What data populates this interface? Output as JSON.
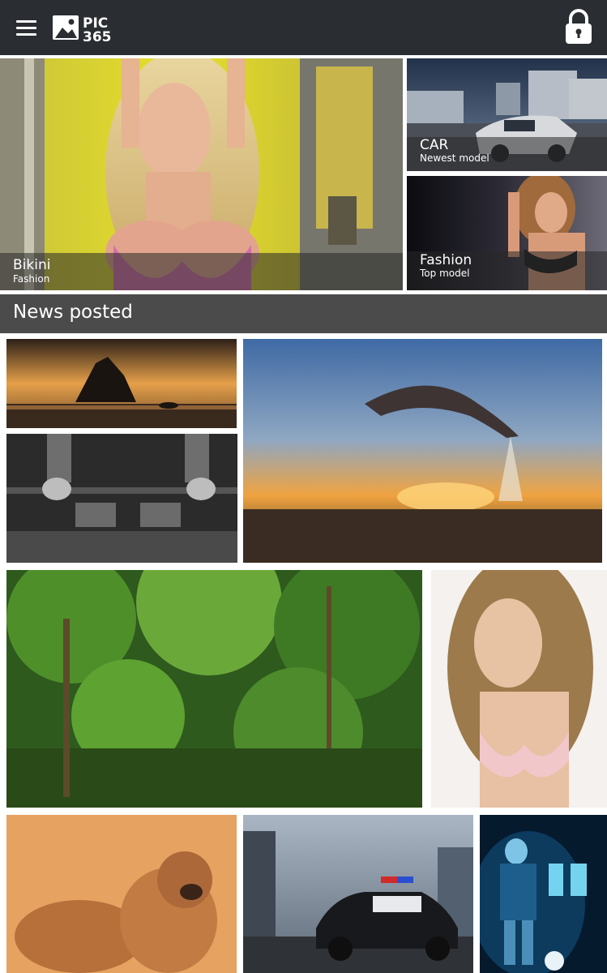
{
  "header": {
    "logo_text_line1": "PIC",
    "logo_text_line2": "365"
  },
  "featured": [
    {
      "title": "Bikini",
      "subtitle": "Fashion"
    },
    {
      "title": "CAR",
      "subtitle": "Newest model"
    },
    {
      "title": "Fashion",
      "subtitle": "Top model"
    }
  ],
  "news": {
    "heading": "News posted"
  },
  "photos": [
    {
      "subject": "sunset beach rock"
    },
    {
      "subject": "barbell lifter"
    },
    {
      "subject": "dolphin jumping at sunset"
    },
    {
      "subject": "green jungle"
    },
    {
      "subject": "model portrait"
    },
    {
      "subject": "shar pei puppies"
    },
    {
      "subject": "police car"
    },
    {
      "subject": "football player poster"
    }
  ],
  "colors": {
    "header_bg": "#2a2d31",
    "section_bar": "#4b4b4b",
    "page_bg": "#ffffff"
  }
}
